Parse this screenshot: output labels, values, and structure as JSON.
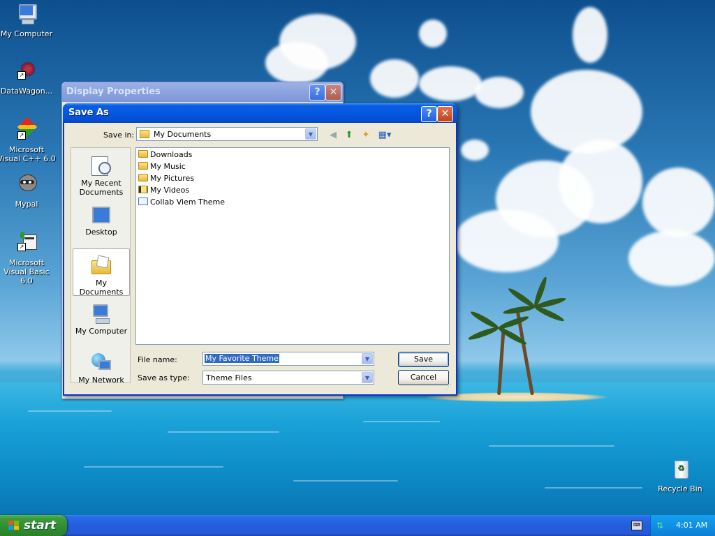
{
  "desktop": {
    "icons": [
      {
        "label": "My Computer"
      },
      {
        "label": "DataWagon..."
      },
      {
        "label": "Microsoft Visual C++ 6.0"
      },
      {
        "label": "Mypal"
      },
      {
        "label": "Microsoft Visual Basic 6.0"
      },
      {
        "label": "Recycle Bin"
      }
    ]
  },
  "background_window": {
    "title": "Display Properties"
  },
  "dialog": {
    "title": "Save As",
    "save_in_label": "Save in:",
    "save_in_value": "My Documents",
    "places": [
      "My Recent Documents",
      "Desktop",
      "My Documents",
      "My Computer",
      "My Network"
    ],
    "selected_place": "My Documents",
    "files": [
      "Downloads",
      "My Music",
      "My Pictures",
      "My Videos",
      "Collab Viem Theme"
    ],
    "file_name_label": "File name:",
    "file_name_value": "My Favorite Theme",
    "save_type_label": "Save as type:",
    "save_type_value": "Theme Files",
    "save_button": "Save",
    "cancel_button": "Cancel",
    "help_button": "?",
    "close_button": "✕"
  },
  "taskbar": {
    "start_label": "start",
    "clock": "4:01 AM"
  }
}
